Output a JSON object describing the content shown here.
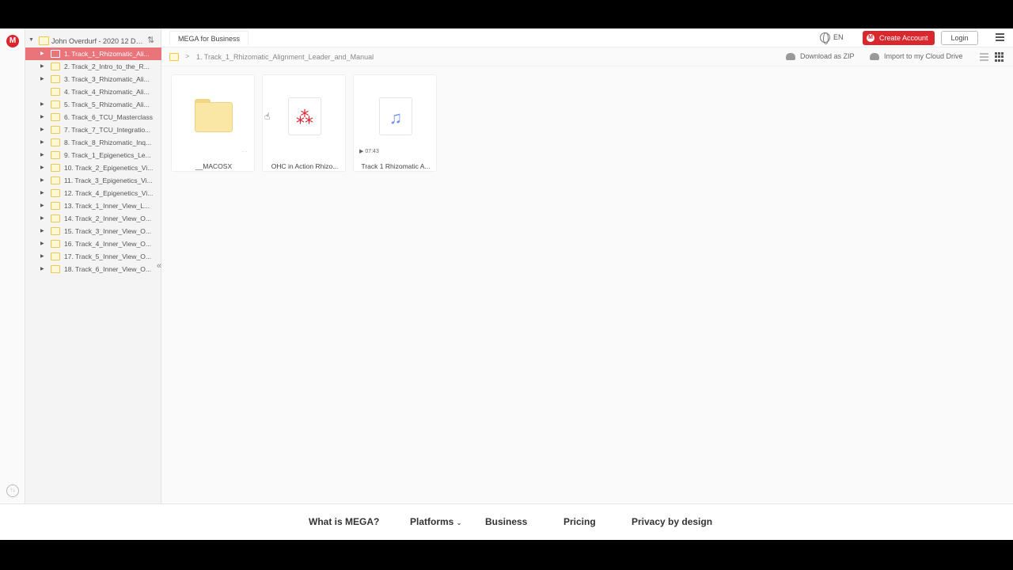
{
  "tree": {
    "root_title": "John Overdurf - 2020 12 Da...",
    "items": [
      {
        "label": "1. Track_1_Rhizomatic_Ali...",
        "expandable": true,
        "selected": true
      },
      {
        "label": "2. Track_2_Intro_to_the_R...",
        "expandable": true
      },
      {
        "label": "3. Track_3_Rhizomatic_Ali...",
        "expandable": true
      },
      {
        "label": "4. Track_4_Rhizomatic_Ali...",
        "expandable": false
      },
      {
        "label": "5. Track_5_Rhizomatic_Ali...",
        "expandable": true
      },
      {
        "label": "6. Track_6_TCU_Masterclass",
        "expandable": true
      },
      {
        "label": "7. Track_7_TCU_Integratio...",
        "expandable": true
      },
      {
        "label": "8. Track_8_Rhizomatic_Inq...",
        "expandable": true
      },
      {
        "label": "9. Track_1_Epigenetics_Le...",
        "expandable": true
      },
      {
        "label": "10. Track_2_Epigenetics_Vi...",
        "expandable": true
      },
      {
        "label": "11. Track_3_Epigenetics_Vi...",
        "expandable": true
      },
      {
        "label": "12. Track_4_Epigenetics_Vi...",
        "expandable": true
      },
      {
        "label": "13. Track_1_Inner_View_L...",
        "expandable": true
      },
      {
        "label": "14. Track_2_Inner_View_O...",
        "expandable": true
      },
      {
        "label": "15. Track_3_Inner_View_O...",
        "expandable": true
      },
      {
        "label": "16. Track_4_Inner_View_O...",
        "expandable": true
      },
      {
        "label": "17. Track_5_Inner_View_O...",
        "expandable": true
      },
      {
        "label": "18. Track_6_Inner_View_O...",
        "expandable": true
      }
    ]
  },
  "topbar": {
    "business_tab": "MEGA for Business",
    "language": "EN",
    "create_account": "Create Account",
    "login": "Login"
  },
  "breadcrumb": {
    "path": "1. Track_1_Rhizomatic_Alignment_Leader_and_Manual",
    "download_zip": "Download as ZIP",
    "import": "Import to my Cloud Drive"
  },
  "files": [
    {
      "name": "__MACOSX",
      "type": "folder"
    },
    {
      "name": "OHC in Action Rhizo...",
      "type": "pdf"
    },
    {
      "name": "Track 1 Rhizomatic A...",
      "type": "audio",
      "duration": "07:43"
    }
  ],
  "footer": {
    "what_is_mega": "What is MEGA?",
    "platforms": "Platforms",
    "business": "Business",
    "pricing": "Pricing",
    "privacy": "Privacy by design"
  },
  "colors": {
    "brand_red": "#d9272e",
    "selected_row": "#e9747a",
    "folder_yellow": "#fae7a5"
  },
  "icons": {
    "logo": "M"
  }
}
